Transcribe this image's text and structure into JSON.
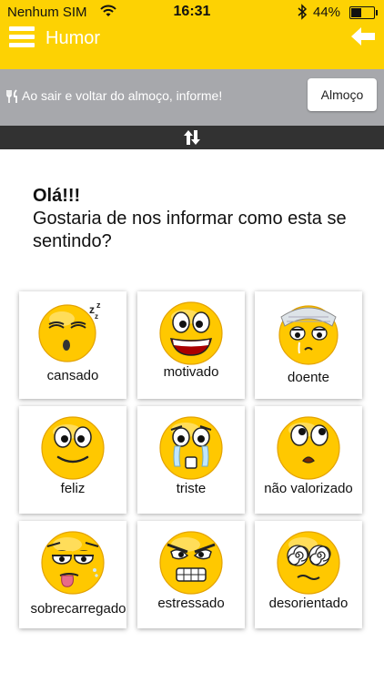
{
  "status_bar": {
    "carrier": "Nenhum SIM",
    "time": "16:31",
    "battery": "44%",
    "battery_fraction": 0.44
  },
  "nav": {
    "title": "Humor"
  },
  "lunch": {
    "text": "Ao sair e voltar do almoço, informe!",
    "button": "Almoço"
  },
  "greeting": "Olá!!!",
  "question": "Gostaria de nos informar como esta se sentindo?",
  "moods": [
    {
      "label": "cansado",
      "icon": "sleepy-face-icon"
    },
    {
      "label": "motivado",
      "icon": "grinning-face-icon"
    },
    {
      "label": "doente",
      "icon": "sick-face-icon"
    },
    {
      "label": "feliz",
      "icon": "happy-face-icon"
    },
    {
      "label": "triste",
      "icon": "crying-face-icon"
    },
    {
      "label": "não valorizado",
      "icon": "unappreciated-face-icon"
    },
    {
      "label": "sobrecarregado",
      "icon": "exhausted-face-icon"
    },
    {
      "label": "estressado",
      "icon": "angry-face-icon"
    },
    {
      "label": "desorientado",
      "icon": "dizzy-face-icon"
    }
  ],
  "colors": {
    "header": "#fdd203",
    "lunch_bar": "#a7a8ac",
    "drag_bar": "#323232",
    "emoji": "#ffc800"
  }
}
